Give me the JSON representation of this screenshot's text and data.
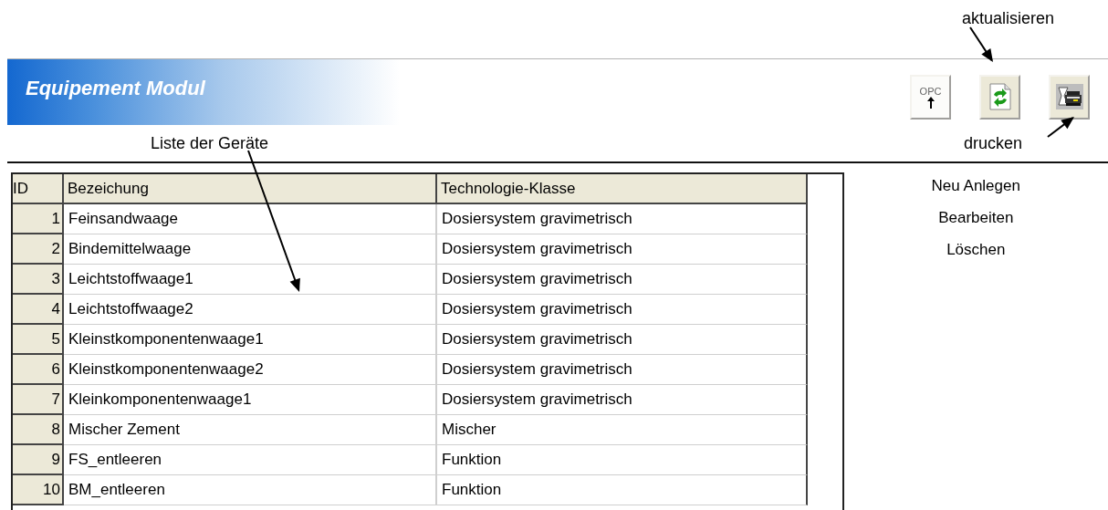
{
  "annotations": [
    {
      "text": "aktualisieren"
    },
    {
      "text": "Liste der Geräte"
    },
    {
      "text": "drucken"
    }
  ],
  "header": {
    "title": "Equipement Modul"
  },
  "toolbar": [
    {
      "kind": "opc",
      "label": "OPC"
    },
    {
      "kind": "refresh"
    },
    {
      "kind": "print"
    }
  ],
  "table": {
    "columns": [
      "ID",
      "Bezeichung",
      "Technologie-Klasse"
    ],
    "rows": [
      [
        "1",
        "Feinsandwaage",
        "Dosiersystem gravimetrisch"
      ],
      [
        "2",
        "Bindemittelwaage",
        "Dosiersystem gravimetrisch"
      ],
      [
        "3",
        "Leichtstoffwaage1",
        "Dosiersystem gravimetrisch"
      ],
      [
        "4",
        "Leichtstoffwaage2",
        "Dosiersystem gravimetrisch"
      ],
      [
        "5",
        "Kleinstkomponentenwaage1",
        "Dosiersystem gravimetrisch"
      ],
      [
        "6",
        "Kleinstkomponentenwaage2",
        "Dosiersystem gravimetrisch"
      ],
      [
        "7",
        "Kleinkomponentenwaage1",
        "Dosiersystem gravimetrisch"
      ],
      [
        "8",
        "Mischer Zement",
        "Mischer"
      ],
      [
        "9",
        "FS_entleeren",
        "Funktion"
      ],
      [
        "10",
        "BM_entleeren",
        "Funktion"
      ]
    ]
  },
  "actions": [
    "Neu Anlegen",
    "Bearbeiten",
    "Löschen"
  ]
}
